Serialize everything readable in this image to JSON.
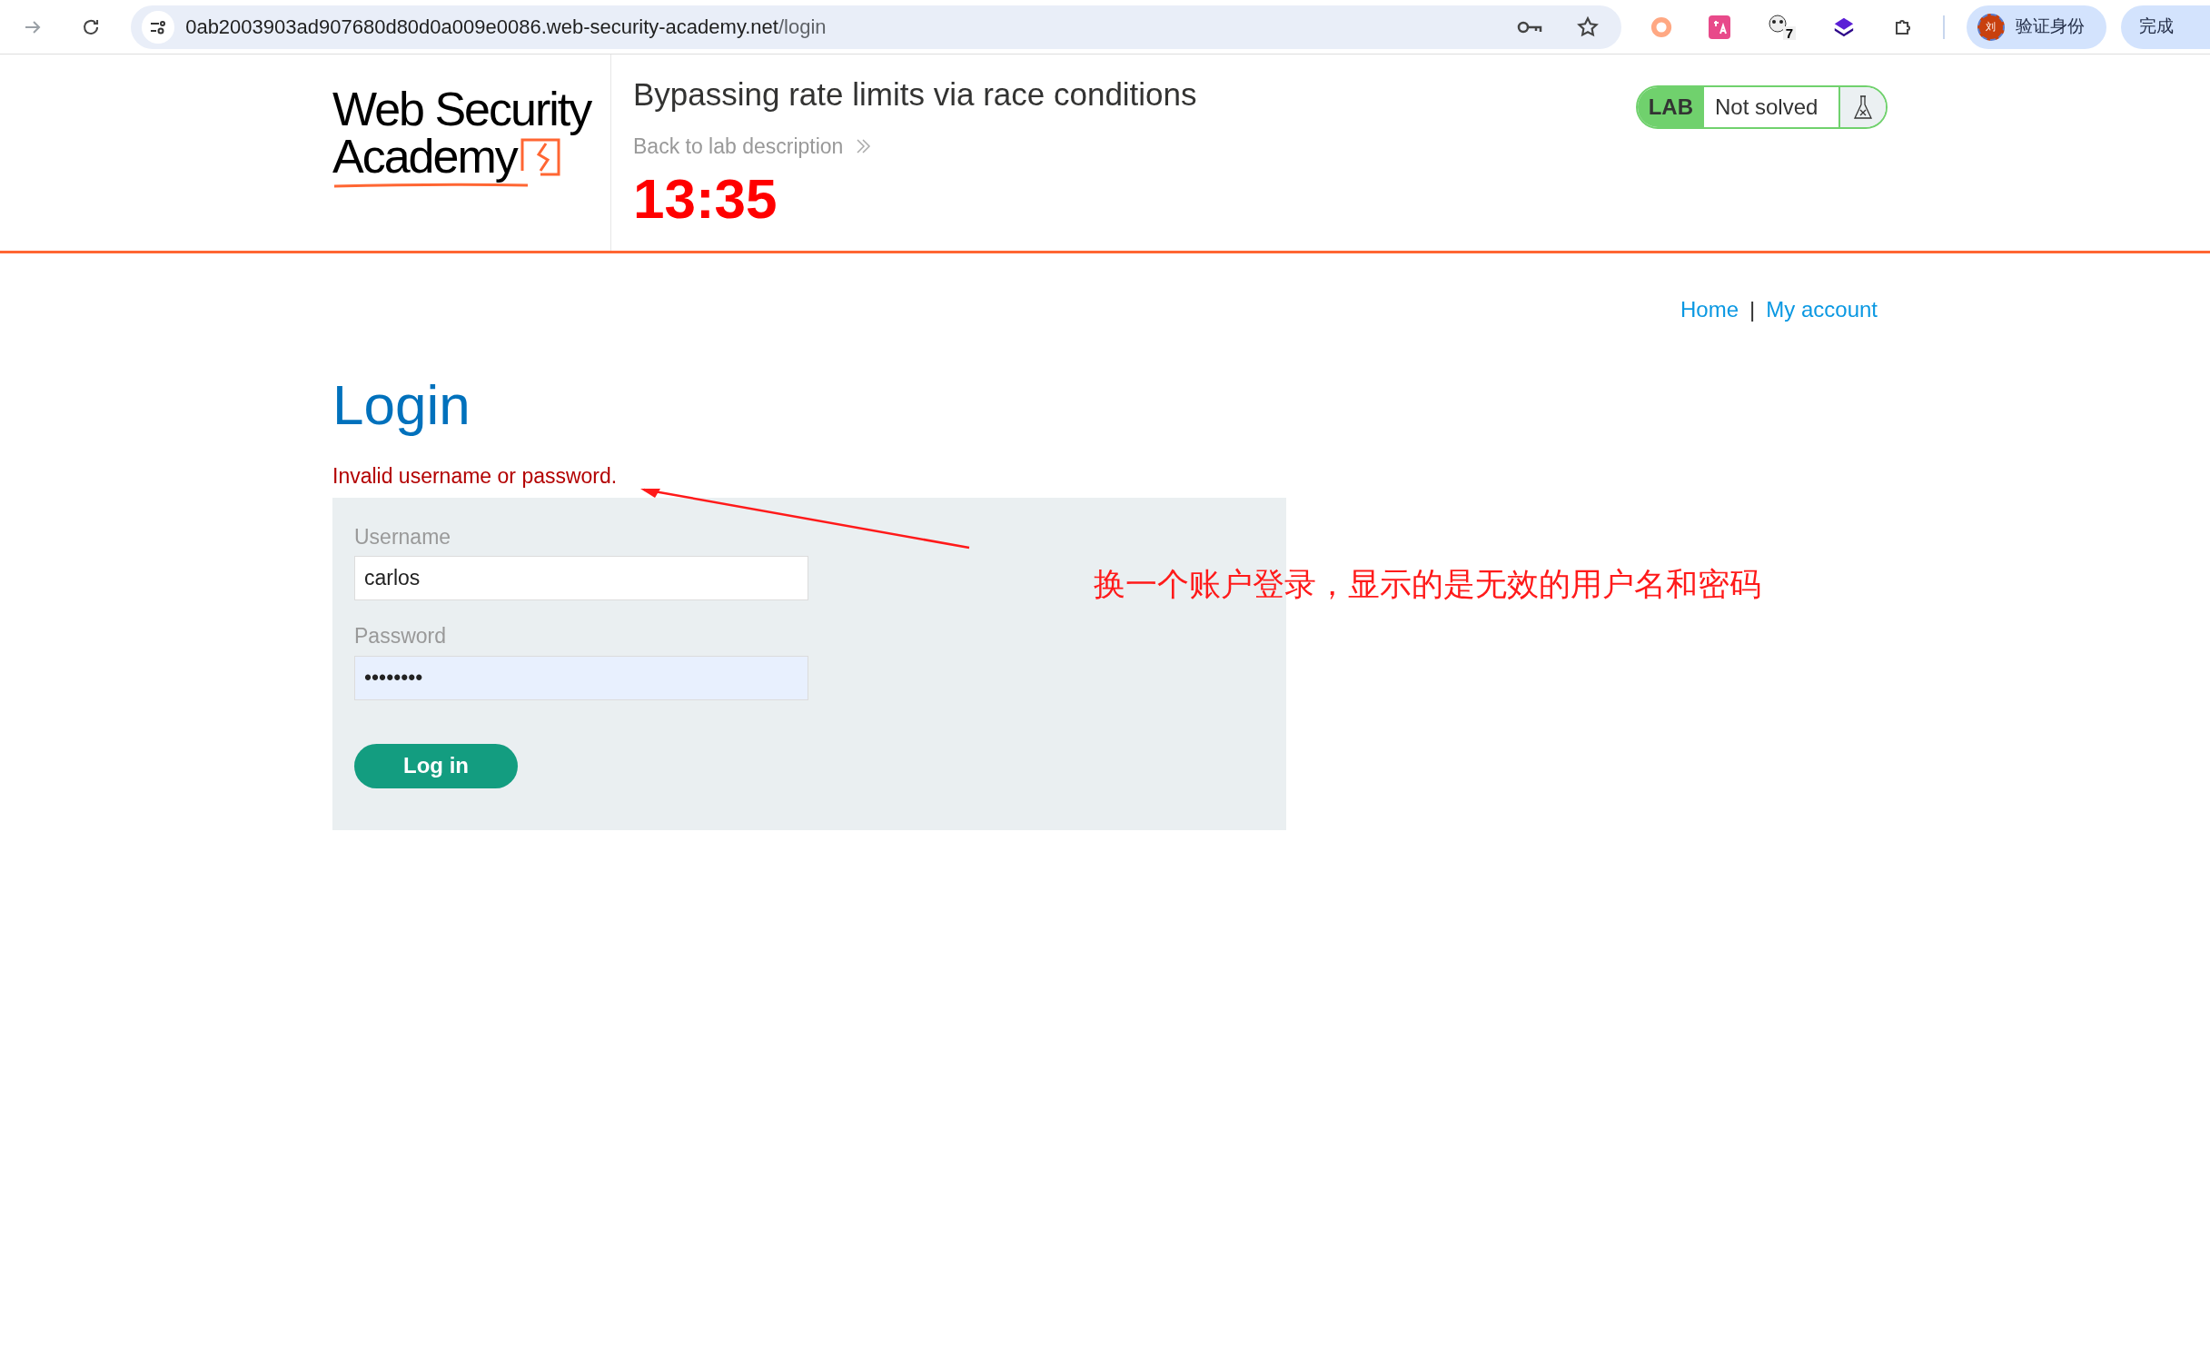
{
  "browser": {
    "url_host": "0ab2003903ad907680d80d0a009e0086.web-security-academy.net",
    "url_path": "/login",
    "extension_badge": "7",
    "profile_initial": "刘",
    "profile_label": "验证身份",
    "update_button": "完成"
  },
  "header": {
    "logo_line_1": "Web Security",
    "logo_line_2": "Academy",
    "lab_title": "Bypassing rate limits via race conditions",
    "back_link": "Back to lab description",
    "timer": "13:35",
    "lab_badge": "LAB",
    "status": "Not solved"
  },
  "nav": [
    "Home",
    "|",
    "My account"
  ],
  "login": {
    "heading": "Login",
    "error": "Invalid username or password.",
    "fields": [
      {
        "label": "Username",
        "value": "carlos",
        "autofilled": false
      },
      {
        "label": "Password",
        "value": "••••••••",
        "autofilled": true
      }
    ],
    "submit": "Log in"
  },
  "annotation": "换一个账户登录，显示的是无效的用户名和密码"
}
